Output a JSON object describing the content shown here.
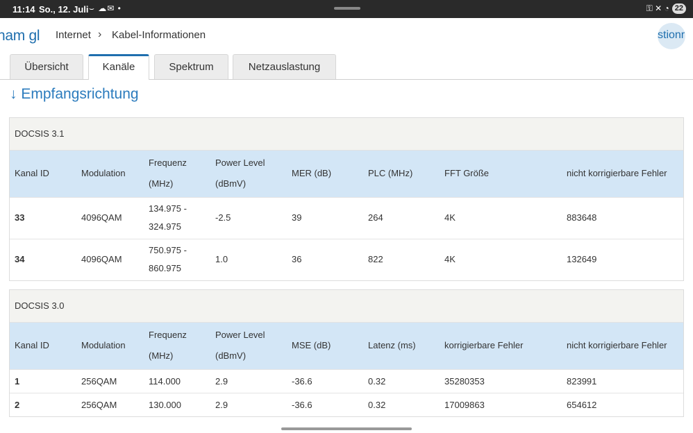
{
  "statusbar": {
    "time": "11:14",
    "date": "So., 12. Juli",
    "notifications": "⌣ ☁✉ •",
    "system_icons": "⚿ ✕ ◔",
    "battery": "22"
  },
  "header": {
    "logo_text": "ham gl",
    "breadcrumb": [
      "Internet",
      "Kabel-Informationen"
    ],
    "breadcrumb_separator": "›",
    "avatar_text": "stionr"
  },
  "tabs": [
    {
      "label": "Übersicht",
      "active": false
    },
    {
      "label": "Kanäle",
      "active": true
    },
    {
      "label": "Spektrum",
      "active": false
    },
    {
      "label": "Netzauslastung",
      "active": false
    }
  ],
  "section_title": "↓ Empfangsrichtung",
  "docsis31": {
    "title": "DOCSIS 3.1",
    "headers": [
      "Kanal ID",
      "Modulation",
      "Frequenz (MHz)",
      "Power Level (dBmV)",
      "MER (dB)",
      "PLC (MHz)",
      "FFT Größe",
      "nicht korrigierbare Fehler"
    ],
    "rows": [
      [
        "33",
        "4096QAM",
        "134.975 - 324.975",
        "-2.5",
        "39",
        "264",
        "4K",
        "883648"
      ],
      [
        "34",
        "4096QAM",
        "750.975 - 860.975",
        "1.0",
        "36",
        "822",
        "4K",
        "132649"
      ]
    ]
  },
  "docsis30": {
    "title": "DOCSIS 3.0",
    "headers": [
      "Kanal ID",
      "Modulation",
      "Frequenz (MHz)",
      "Power Level (dBmV)",
      "MSE (dB)",
      "Latenz (ms)",
      "korrigierbare Fehler",
      "nicht korrigierbare Fehler"
    ],
    "rows": [
      [
        "1",
        "256QAM",
        "114.000",
        "2.9",
        "-36.6",
        "0.32",
        "35280353",
        "823991"
      ],
      [
        "2",
        "256QAM",
        "130.000",
        "2.9",
        "-36.6",
        "0.32",
        "17009863",
        "654612"
      ]
    ]
  },
  "colors": {
    "accent": "#1f6fae",
    "header_row": "#d3e6f6",
    "block_title_bg": "#f3f3f0"
  }
}
